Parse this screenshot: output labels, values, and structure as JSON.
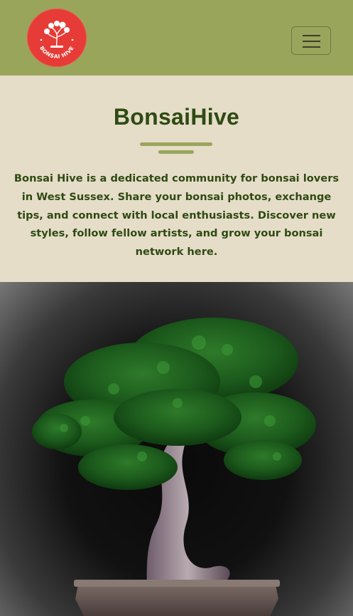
{
  "navbar": {
    "logo_alt": "Bonsai Hive",
    "logo_text": "BONSAI HIVE",
    "toggle_label": "Toggle navigation"
  },
  "hero": {
    "title": "BonsaiHive",
    "intro": "Bonsai Hive is a dedicated community for bonsai lovers in West Sussex. Share your bonsai photos, exchange tips, and connect with local enthusiasts. Discover new styles, follow fellow artists, and grow your bonsai network here."
  },
  "colors": {
    "navbar_bg": "#9aa55c",
    "page_bg": "#e5ddc8",
    "text_dark_green": "#2f4a13",
    "logo_red": "#e63b36",
    "accent_olive": "#9aa55c"
  },
  "image": {
    "subject": "bonsai tree in ceramic pot"
  }
}
